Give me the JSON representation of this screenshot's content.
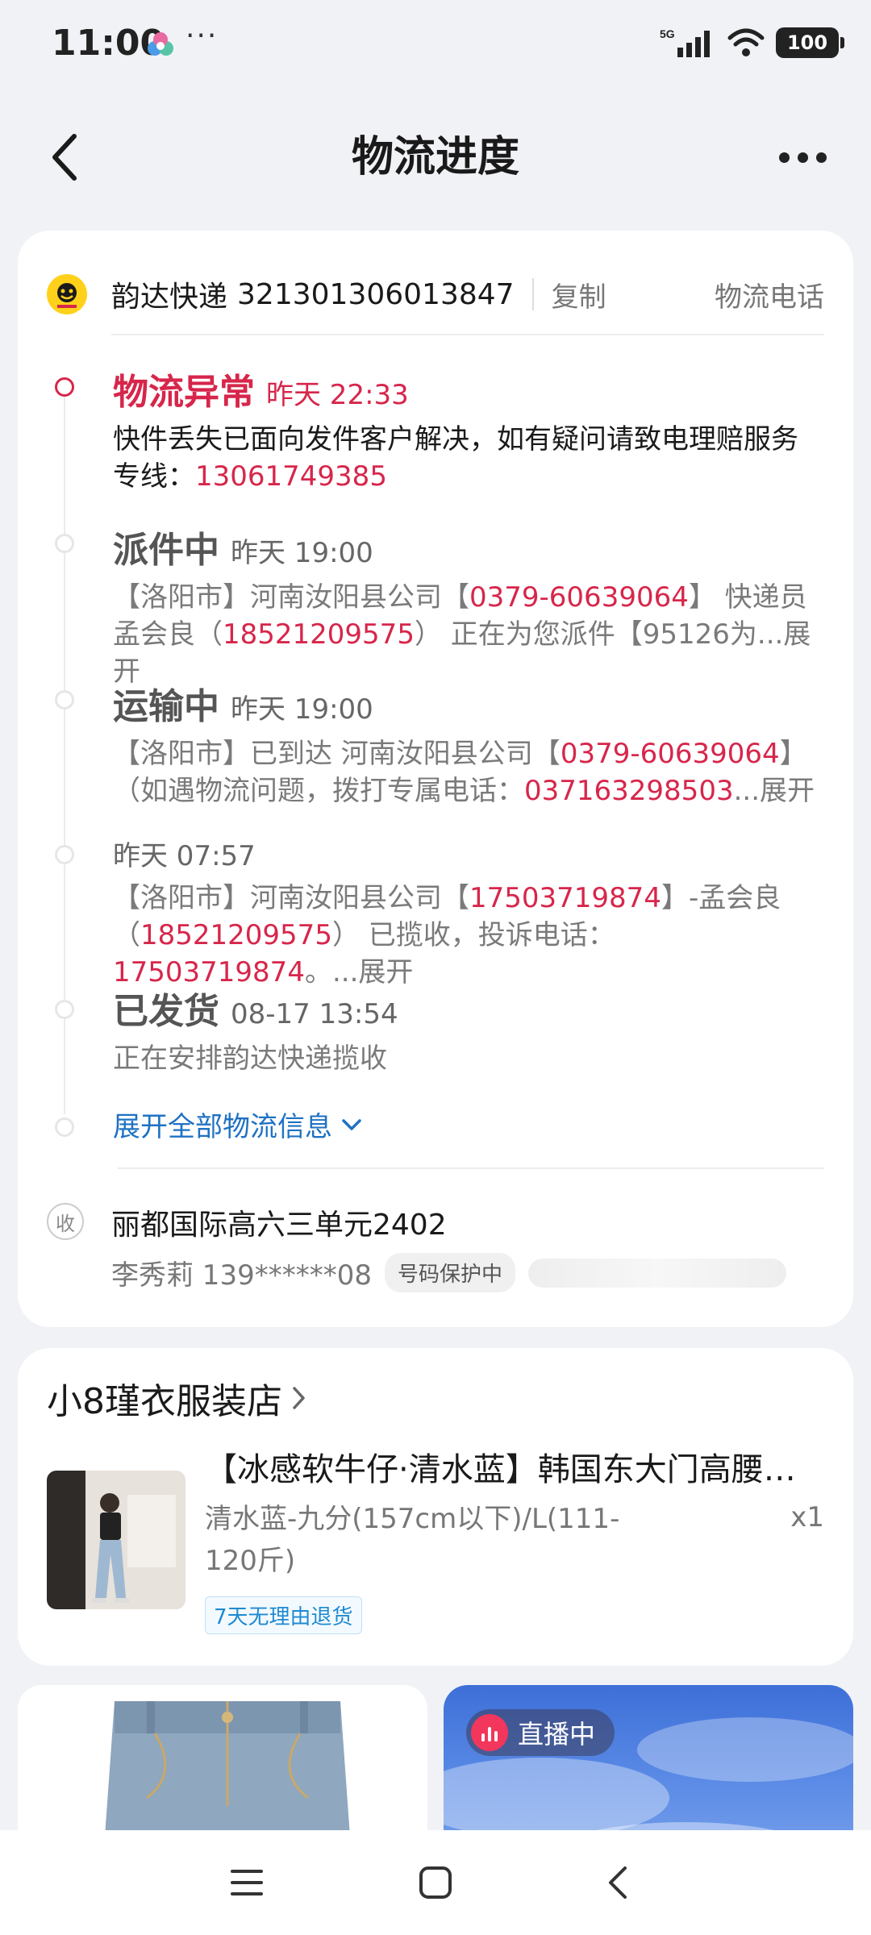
{
  "status_bar": {
    "time": "11:00",
    "dots": "···",
    "network": "5G",
    "battery": "100"
  },
  "header": {
    "title": "物流进度"
  },
  "courier": {
    "name": "韵达快递",
    "tracking_number": "321301306013847",
    "copy_label": "复制",
    "phone_label": "物流电话"
  },
  "timeline": [
    {
      "status": "物流异常",
      "time": "昨天 22:33",
      "desc_a": "快件丢失已面向发件客户解决，如有疑问请致电理赔服务专线：",
      "desc_phone": "13061749385"
    },
    {
      "status": "派件中",
      "time": "昨天 19:00",
      "desc_a": "【洛阳市】河南汝阳县公司【",
      "desc_phone1": "0379-60639064",
      "desc_b": "】 快递员孟会良（",
      "desc_phone2": "18521209575",
      "desc_c": "） 正在为您派件【95126为...",
      "expand": "展开"
    },
    {
      "status": "运输中",
      "time": "昨天 19:00",
      "desc_a": "【洛阳市】已到达 河南汝阳县公司【",
      "desc_phone1": "0379-60639064",
      "desc_b": "】（如遇物流问题，拨打专属电话：",
      "desc_phone2": "037163298503",
      "desc_c": "...",
      "expand": "展开"
    },
    {
      "status": "",
      "time": "昨天 07:57",
      "desc_a": "【洛阳市】河南汝阳县公司【",
      "desc_phone1": "17503719874",
      "desc_b": "】-孟会良（",
      "desc_phone2": "18521209575",
      "desc_c": "） 已揽收，投诉电话：",
      "desc_phone3": "17503719874",
      "desc_d": "。...",
      "expand": "展开"
    },
    {
      "status": "已发货",
      "time": "08-17 13:54",
      "desc_a": "正在安排韵达快递揽收"
    }
  ],
  "expand_all_label": "展开全部物流信息",
  "address": {
    "icon_label": "收",
    "text": "丽都国际高六三单元2402",
    "receiver": "李秀莉 139******08",
    "protect_label": "号码保护中"
  },
  "shop": {
    "name": "小8瑾衣服装店",
    "product_title": "【冰感软牛仔·清水蓝】韩国东大门高腰…",
    "product_spec": "清水蓝-九分(157cm以下)/L(111-120斤)",
    "qty": "x1",
    "return_badge": "7天无理由退货"
  },
  "recommend": {
    "live_label": "直播中"
  },
  "colors": {
    "accent_red": "#d7264b",
    "link_blue": "#1f72c3",
    "courier_yellow": "#ffd11a"
  }
}
